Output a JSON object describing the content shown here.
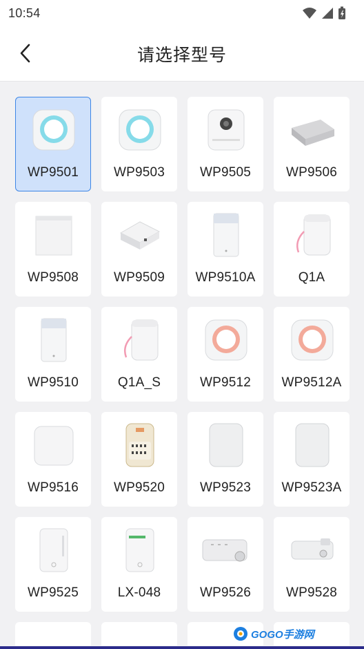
{
  "status_bar": {
    "time": "10:54"
  },
  "header": {
    "title": "请选择型号"
  },
  "models": [
    {
      "label": "WP9501",
      "icon": "round-printer-blue",
      "selected": true
    },
    {
      "label": "WP9503",
      "icon": "round-printer-blue"
    },
    {
      "label": "WP9505",
      "icon": "camera-printer"
    },
    {
      "label": "WP9506",
      "icon": "flat-box-printer"
    },
    {
      "label": "WP9508",
      "icon": "cube-printer"
    },
    {
      "label": "WP9509",
      "icon": "square-tilted-printer"
    },
    {
      "label": "WP9510A",
      "icon": "tall-printer"
    },
    {
      "label": "Q1A",
      "icon": "strap-printer"
    },
    {
      "label": "WP9510",
      "icon": "tall-printer"
    },
    {
      "label": "Q1A_S",
      "icon": "strap-printer"
    },
    {
      "label": "WP9512",
      "icon": "round-printer-pink"
    },
    {
      "label": "WP9512A",
      "icon": "round-printer-pink"
    },
    {
      "label": "WP9516",
      "icon": "rounded-square-printer"
    },
    {
      "label": "WP9520",
      "icon": "gold-printer"
    },
    {
      "label": "WP9523",
      "icon": "rounded-rect-printer"
    },
    {
      "label": "WP9523A",
      "icon": "rounded-rect-printer"
    },
    {
      "label": "WP9525",
      "icon": "upright-printer"
    },
    {
      "label": "LX-048",
      "icon": "upright-printer-green-logo"
    },
    {
      "label": "WP9526",
      "icon": "roll-printer"
    },
    {
      "label": "WP9528",
      "icon": "roll-printer-small"
    }
  ],
  "partial_row_count": 4,
  "watermark": {
    "text": "GOGO手游网"
  },
  "colors": {
    "selected_bg": "#cfe1fb",
    "selected_border": "#3d86e6",
    "accent_blue": "#7fd6ea",
    "accent_pink": "#f2a596"
  }
}
